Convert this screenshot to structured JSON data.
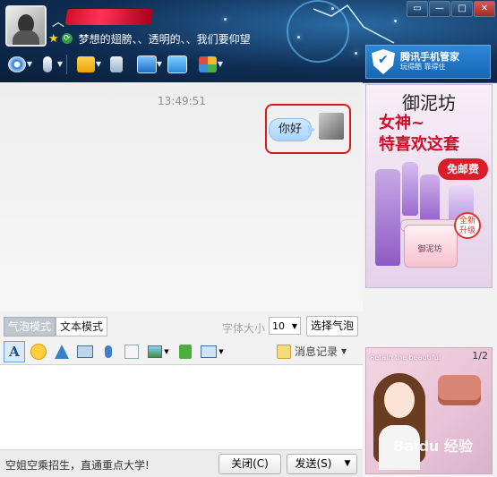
{
  "header": {
    "contact_name": "",
    "signature": "梦想的翅膀、、透明的、、我们要仰望",
    "window_controls": [
      "▭",
      "—",
      "□",
      "✕"
    ]
  },
  "toolbar": {
    "items": [
      "video-call",
      "voice-call",
      "send-file",
      "sms",
      "remote-desktop",
      "share-screen",
      "apps"
    ]
  },
  "tencent_banner": {
    "title": "腾讯手机管家",
    "subtitle": "玩得酷 靠得住"
  },
  "chat": {
    "timestamp": "13:49:51",
    "message": "你好"
  },
  "ad1": {
    "brand": "御泥坊",
    "headline_1": "女神~",
    "headline_2": "特喜欢这套",
    "badge": "免邮费",
    "seal": "全新升级"
  },
  "mode": {
    "bubble_mode": "气泡模式",
    "text_mode": "文本模式",
    "font_size_label": "字体大小",
    "font_size": "10",
    "choose_bubble": "选择气泡"
  },
  "input_toolbar": {
    "history": "消息记录"
  },
  "bottom": {
    "promo": "空姐空乘招生，直通重点大学!",
    "close": "关闭(C)",
    "send": "发送(S)"
  },
  "ad2": {
    "text": "Retain the beautiful",
    "page": "1/2",
    "watermark": "Baidu 经验"
  },
  "colors": {
    "header_dark": "#0f2d53",
    "accent_red": "#d91a1a",
    "bubble_blue": "#a9d3fa"
  }
}
